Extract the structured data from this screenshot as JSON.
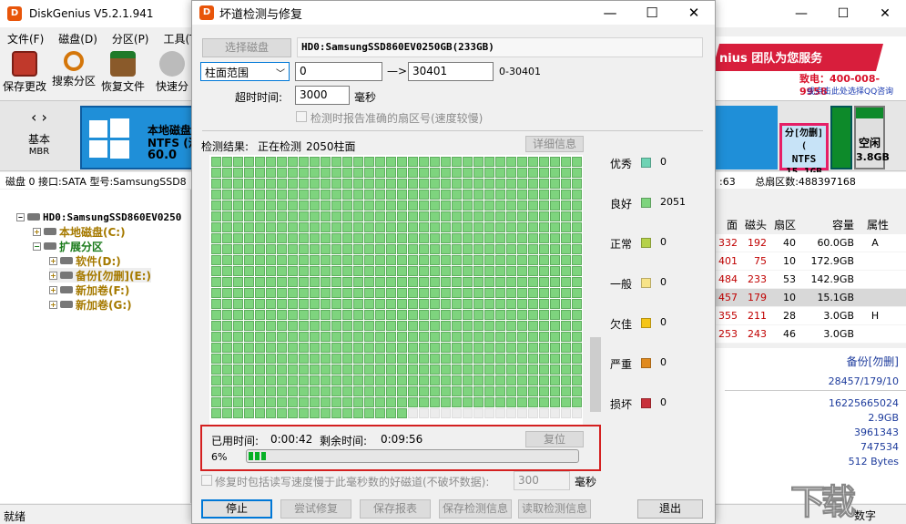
{
  "main": {
    "title": "DiskGenius V5.2.1.941",
    "logo_letter": "D",
    "window_controls": {
      "minimize": "—",
      "maximize": "☐",
      "close": "✕"
    },
    "menu": [
      "文件(F)",
      "磁盘(D)",
      "分区(P)",
      "工具(T)"
    ],
    "toolbar": [
      {
        "label": "保存更改",
        "icon": "save-icon",
        "color": "#c0392b"
      },
      {
        "label": "搜索分区",
        "icon": "magnifier-icon",
        "color": "#d4760a"
      },
      {
        "label": "恢复文件",
        "icon": "recover-box-icon",
        "color": "#1f7a2a"
      },
      {
        "label": "快速分",
        "icon": "quick-partition-icon",
        "color": "#888888"
      }
    ],
    "ad": {
      "slogan": "nius 团队为您服务",
      "phone": "致电：400-008-9958",
      "qq": "或点击此处选择QQ咨询"
    },
    "diskmap": {
      "nav_arrows": "‹ ›",
      "basic_line1": "基本",
      "basic_line2": "MBR",
      "part_c_line1": "本地磁盘",
      "part_c_line2": "NTFS (活",
      "part_c_line3": "60.0",
      "part_e_line1": "分[勿删](",
      "part_e_line2": "NTFS",
      "part_e_line3": "15.1GB",
      "free_line1": "空闲",
      "free_line2": "3.8GB"
    },
    "info_bar": "磁盘 0 接口:SATA  型号:SamsungSSD8",
    "info_bar_right_1": ":63",
    "info_bar_right_2": "总扇区数:488397168",
    "tree": {
      "disk": "HD0:SamsungSSD860EV0250",
      "items": [
        {
          "label": "本地磁盘(C:)",
          "color": "#a67a00"
        },
        {
          "label": "扩展分区",
          "color": "#1a7a1a"
        },
        {
          "label": "软件(D:)",
          "color": "#a67a00"
        },
        {
          "label": "备份[勿删](E:)",
          "color": "#a67a00"
        },
        {
          "label": "新加卷(F:)",
          "color": "#a67a00"
        },
        {
          "label": "新加卷(G:)",
          "color": "#a67a00"
        }
      ]
    },
    "table": {
      "headers": [
        "面",
        "磁头",
        "扇区",
        "容量",
        "属性"
      ],
      "rows": [
        [
          "332",
          "192",
          "40",
          "60.0GB",
          "A"
        ],
        [
          "401",
          "75",
          "10",
          "172.9GB",
          ""
        ],
        [
          "484",
          "233",
          "53",
          "142.9GB",
          ""
        ],
        [
          "457",
          "179",
          "10",
          "15.1GB",
          ""
        ],
        [
          "355",
          "211",
          "28",
          "3.0GB",
          "H"
        ],
        [
          "253",
          "243",
          "46",
          "3.0GB",
          ""
        ]
      ],
      "selected_row": 3
    },
    "details": {
      "name": "备份[勿删]",
      "chs": "28457/179/10",
      "values": [
        "16225665024",
        "2.9GB",
        "3961343",
        "747534",
        "512 Bytes"
      ]
    },
    "status_left": "就绪",
    "status_right": "数字"
  },
  "dialog": {
    "title": "坏道检测与修复",
    "logo_letter": "D",
    "controls": {
      "minimize": "—",
      "maximize": "☐",
      "close": "✕"
    },
    "select_disk_button": "选择磁盘",
    "disk_name": "HD0:SamsungSSD860EV0250GB(233GB)",
    "range_mode": "柱面范围",
    "range_start": "0",
    "arrow": "—>",
    "range_end": "30401",
    "range_hint": "0-30401",
    "timeout_label": "超时时间:",
    "timeout_value": "3000",
    "timeout_unit": "毫秒",
    "report_checkbox_label": "检测时报告准确的扇区号(速度较慢)",
    "result_label": "检测结果:",
    "result_status": "正在检测",
    "result_cylinder": "2050柱面",
    "details_button": "详细信息",
    "legend": [
      {
        "label": "优秀",
        "count": "0",
        "color": "#6ed3b4"
      },
      {
        "label": "良好",
        "count": "2051",
        "color": "#7ed47e"
      },
      {
        "label": "正常",
        "count": "0",
        "color": "#b5d14a"
      },
      {
        "label": "一般",
        "count": "0",
        "color": "#f7e388"
      },
      {
        "label": "欠佳",
        "count": "0",
        "color": "#f5c518"
      },
      {
        "label": "严重",
        "count": "0",
        "color": "#e08a1e"
      },
      {
        "label": "损坏",
        "count": "0",
        "color": "#c8303a"
      }
    ],
    "grid": {
      "total_filled": 2051,
      "cells_per_row": 34,
      "rows": 24,
      "filled_cells": 800
    },
    "elapsed_label": "已用时间:",
    "elapsed_value": "0:00:42",
    "remain_label": "剩余时间:",
    "remain_value": "0:09:56",
    "reset_button": "复位",
    "progress_percent_text": "6%",
    "progress_fraction": 0.06,
    "repair_checkbox_label": "修复时包括读写速度慢于此毫秒数的好磁道(不破坏数据):",
    "repair_ms_value": "300",
    "repair_ms_unit": "毫秒",
    "buttons": {
      "stop": "停止",
      "try_repair": "尝试修复",
      "save_report": "保存报表",
      "save_info": "保存检测信息",
      "load_info": "读取检测信息",
      "exit": "退出"
    }
  },
  "watermark": "下载"
}
